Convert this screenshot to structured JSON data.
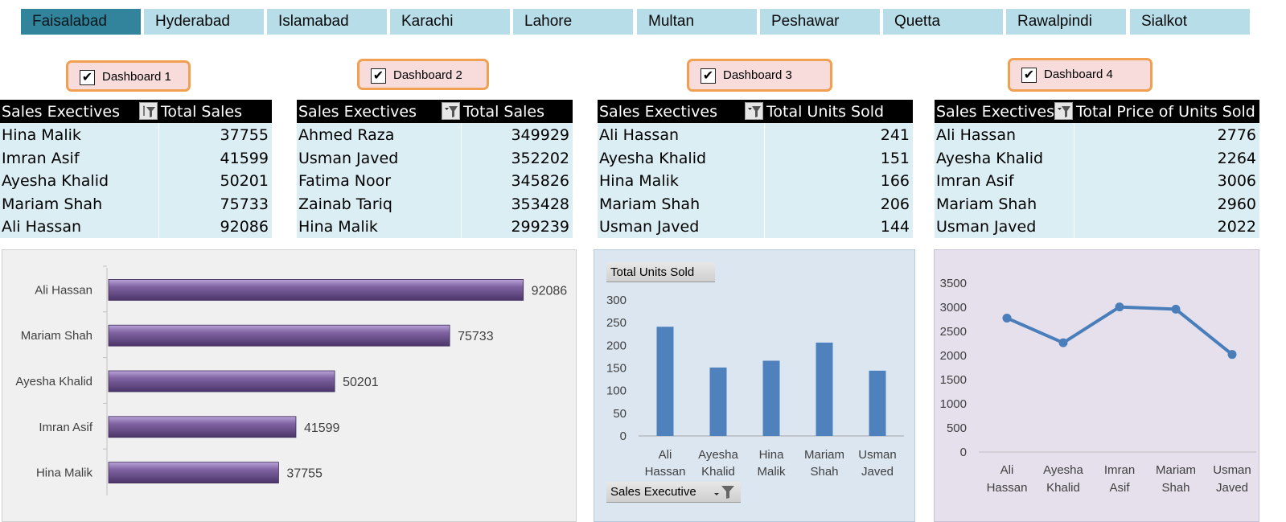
{
  "tabs": [
    {
      "label": "Faisalabad",
      "active": true
    },
    {
      "label": "Hyderabad",
      "active": false
    },
    {
      "label": "Islamabad",
      "active": false
    },
    {
      "label": "Karachi",
      "active": false
    },
    {
      "label": "Lahore",
      "active": false
    },
    {
      "label": "Multan",
      "active": false
    },
    {
      "label": "Peshawar",
      "active": false
    },
    {
      "label": "Quetta",
      "active": false
    },
    {
      "label": "Rawalpindi",
      "active": false
    },
    {
      "label": "Sialkot",
      "active": false
    }
  ],
  "dashboards": [
    {
      "label": "Dashboard 1",
      "checked": true,
      "check_glyph": "✔"
    },
    {
      "label": "Dashboard 2",
      "checked": true,
      "check_glyph": "✔"
    },
    {
      "label": "Dashboard 3",
      "checked": true,
      "check_glyph": "✔"
    },
    {
      "label": "Dashboard 4",
      "checked": true,
      "check_glyph": "✔"
    }
  ],
  "tables": [
    {
      "col1": "Sales Exectives",
      "col2": "Total Sales",
      "filter_icon": "sort-filter-icon",
      "rows": [
        {
          "name": "Hina Malik",
          "value": "37755"
        },
        {
          "name": "Imran Asif",
          "value": "41599"
        },
        {
          "name": "Ayesha Khalid",
          "value": "50201"
        },
        {
          "name": "Mariam Shah",
          "value": "75733"
        },
        {
          "name": "Ali Hassan",
          "value": "92086"
        }
      ]
    },
    {
      "col1": "Sales Exectives",
      "col2": "Total Sales",
      "filter_icon": "filter-icon",
      "rows": [
        {
          "name": "Ahmed Raza",
          "value": "349929"
        },
        {
          "name": "Usman Javed",
          "value": "352202"
        },
        {
          "name": "Fatima Noor",
          "value": "345826"
        },
        {
          "name": "Zainab Tariq",
          "value": "353428"
        },
        {
          "name": "Hina Malik",
          "value": "299239"
        }
      ]
    },
    {
      "col1": "Sales Exectives",
      "col2": "Total Units Sold",
      "filter_icon": "filter-icon",
      "rows": [
        {
          "name": "Ali Hassan",
          "value": "241"
        },
        {
          "name": "Ayesha Khalid",
          "value": "151"
        },
        {
          "name": "Hina Malik",
          "value": "166"
        },
        {
          "name": "Mariam Shah",
          "value": "206"
        },
        {
          "name": "Usman Javed",
          "value": "144"
        }
      ]
    },
    {
      "col1": "Sales Exectives",
      "col2": "Total Price of Units Sold",
      "filter_icon": "filter-icon",
      "rows": [
        {
          "name": "Ali Hassan",
          "value": "2776"
        },
        {
          "name": "Ayesha Khalid",
          "value": "2264"
        },
        {
          "name": "Imran Asif",
          "value": "3006"
        },
        {
          "name": "Mariam Shah",
          "value": "2960"
        },
        {
          "name": "Usman Javed",
          "value": "2022"
        }
      ]
    }
  ],
  "pivot_buttons": {
    "value_field": "Total Units Sold",
    "axis_field": "Sales Executive"
  },
  "colors": {
    "tab_active": "#31849b",
    "tab_inactive": "#b7dde8",
    "bar_purple": "#8064a2",
    "column_blue": "#4f81bd",
    "line_blue": "#4a7ebb"
  },
  "chart_data": [
    {
      "type": "bar",
      "orientation": "horizontal",
      "categories": [
        "Ali Hassan",
        "Mariam Shah",
        "Ayesha Khalid",
        "Imran Asif",
        "Hina Malik"
      ],
      "values": [
        92086,
        75733,
        50201,
        41599,
        37755
      ],
      "data_labels": [
        "92086",
        "75733",
        "50201",
        "41599",
        "37755"
      ],
      "xlim": [
        0,
        100000
      ],
      "grid": false,
      "legend": "none"
    },
    {
      "type": "bar",
      "categories": [
        "Ali Hassan",
        "Ayesha Khalid",
        "Hina Malik",
        "Mariam Shah",
        "Usman Javed"
      ],
      "category_lines": [
        [
          "Ali",
          "Hassan"
        ],
        [
          "Ayesha",
          "Khalid"
        ],
        [
          "Hina",
          "Malik"
        ],
        [
          "Mariam",
          "Shah"
        ],
        [
          "Usman",
          "Javed"
        ]
      ],
      "values": [
        241,
        151,
        166,
        206,
        144
      ],
      "ylim": [
        0,
        300
      ],
      "yticks": [
        "0",
        "50",
        "100",
        "150",
        "200",
        "250",
        "300"
      ],
      "grid": false,
      "legend": "none"
    },
    {
      "type": "line",
      "categories": [
        "Ali Hassan",
        "Ayesha Khalid",
        "Imran Asif",
        "Mariam Shah",
        "Usman Javed"
      ],
      "category_lines": [
        [
          "Ali",
          "Hassan"
        ],
        [
          "Ayesha",
          "Khalid"
        ],
        [
          "Imran",
          "Asif"
        ],
        [
          "Mariam",
          "Shah"
        ],
        [
          "Usman",
          "Javed"
        ]
      ],
      "values": [
        2776,
        2264,
        3006,
        2960,
        2022
      ],
      "ylim": [
        0,
        3500
      ],
      "yticks": [
        "0",
        "500",
        "1000",
        "1500",
        "2000",
        "2500",
        "3000",
        "3500"
      ],
      "markers": true,
      "grid": false,
      "legend": "none"
    }
  ]
}
